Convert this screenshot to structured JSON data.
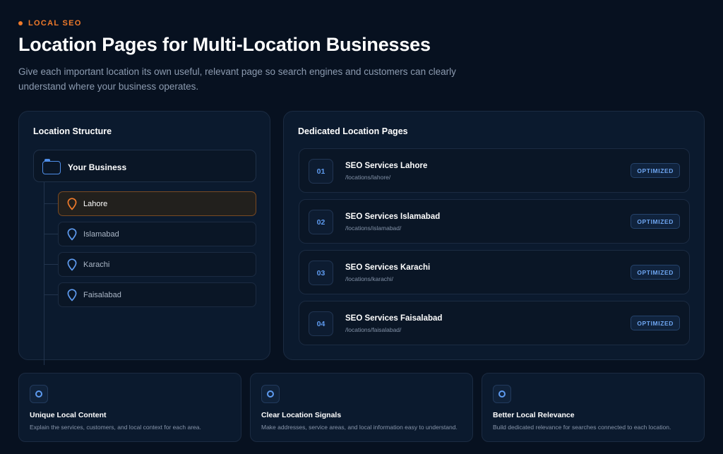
{
  "header": {
    "eyebrow": "LOCAL SEO",
    "title": "Location Pages for Multi-Location Businesses",
    "subtitle": "Give each important location its own useful, relevant page so search engines and customers can clearly understand where your business operates."
  },
  "structure": {
    "title": "Location Structure",
    "root": "Your Business",
    "locations": [
      {
        "label": "Lahore",
        "active": true
      },
      {
        "label": "Islamabad",
        "active": false
      },
      {
        "label": "Karachi",
        "active": false
      },
      {
        "label": "Faisalabad",
        "active": false
      }
    ]
  },
  "pages": {
    "title": "Dedicated Location Pages",
    "rows": [
      {
        "num": "01",
        "title": "SEO Services Lahore",
        "path": "/locations/lahore/",
        "status": "OPTIMIZED"
      },
      {
        "num": "02",
        "title": "SEO Services Islamabad",
        "path": "/locations/islamabad/",
        "status": "OPTIMIZED"
      },
      {
        "num": "03",
        "title": "SEO Services Karachi",
        "path": "/locations/karachi/",
        "status": "OPTIMIZED"
      },
      {
        "num": "04",
        "title": "SEO Services Faisalabad",
        "path": "/locations/faisalabad/",
        "status": "OPTIMIZED"
      }
    ]
  },
  "features": [
    {
      "title": "Unique Local Content",
      "desc": "Explain the services, customers, and local context for each area."
    },
    {
      "title": "Clear Location Signals",
      "desc": "Make addresses, service areas, and local information easy to understand."
    },
    {
      "title": "Better Local Relevance",
      "desc": "Build dedicated relevance for searches connected to each location."
    }
  ],
  "colors": {
    "accent": "#f07a2a",
    "blue": "#5e9bf0",
    "background": "#071120",
    "card": "#0b1a2e"
  },
  "icons": {
    "eyebrow": "dot-icon",
    "root": "folder-icon",
    "location": "map-pin-icon",
    "feature": "circle-icon"
  }
}
